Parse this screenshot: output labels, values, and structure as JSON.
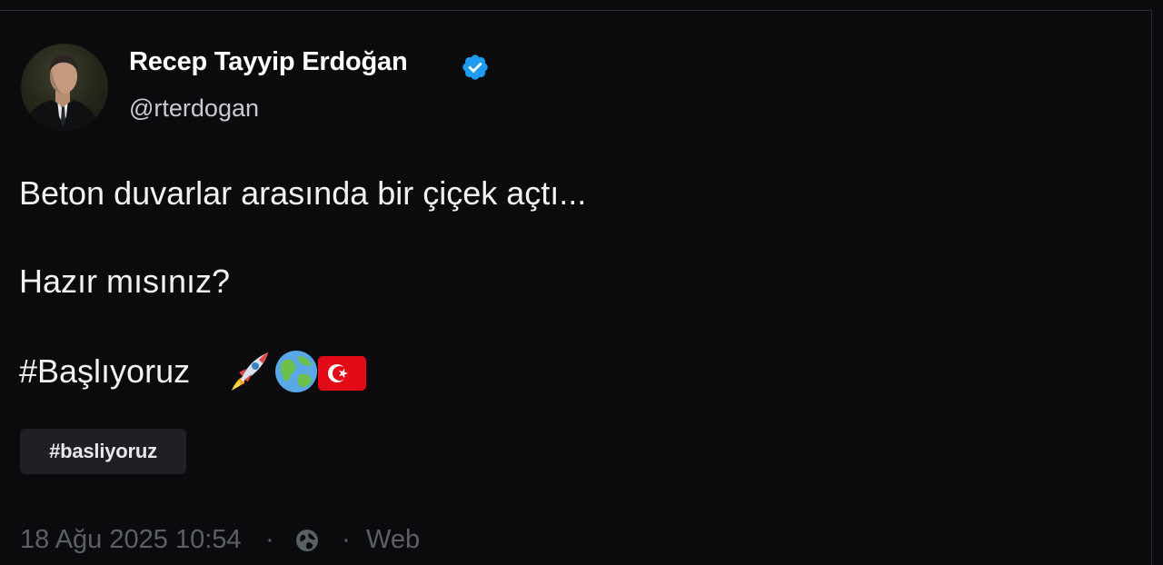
{
  "author": {
    "name": "Recep Tayyip Erdoğan",
    "handle": "@rterdogan",
    "verified": true,
    "verified_color": "#1d9bf0"
  },
  "tweet": {
    "lines": [
      "Beton duvarlar arasında bir çiçek açtı...",
      "Hazır mısınız?",
      "#Başlıyoruz"
    ],
    "emojis": [
      "rocket-emoji",
      "globe-emoji",
      "turkey-flag-emoji"
    ]
  },
  "hashtag_chip": {
    "label": "#basliyoruz"
  },
  "meta": {
    "timestamp": "18 Ağu 2025 10:54",
    "separator": "·",
    "visibility_icon": "globe-icon",
    "source": "Web"
  },
  "colors": {
    "background": "#0b0b0e",
    "chip_background": "#1f2024",
    "muted_text": "#5b6066",
    "flag_red": "#e30a17"
  }
}
